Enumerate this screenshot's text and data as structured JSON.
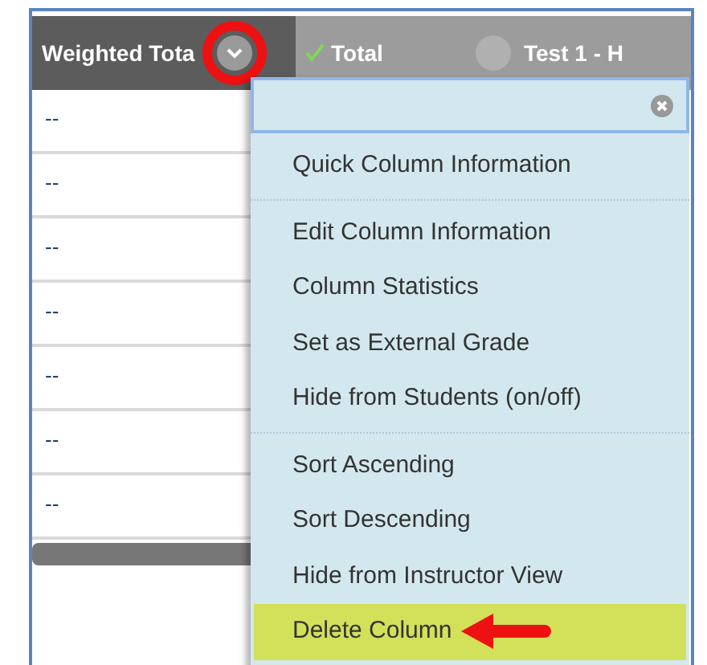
{
  "columns": [
    {
      "title": "Weighted Tota",
      "kind": "menu-open"
    },
    {
      "title": "Total",
      "kind": "checked"
    },
    {
      "title": "Test 1 - H",
      "kind": "menu"
    }
  ],
  "rows": [
    "--",
    "--",
    "--",
    "--",
    "--",
    "--",
    "--"
  ],
  "menu": {
    "groups": [
      [
        {
          "label": "Quick Column Information",
          "selected": false
        }
      ],
      [
        {
          "label": "Edit Column Information",
          "selected": false
        },
        {
          "label": "Column Statistics",
          "selected": false
        },
        {
          "label": "Set as External Grade",
          "selected": false
        },
        {
          "label": "Hide from Students (on/off)",
          "selected": false
        }
      ],
      [
        {
          "label": "Sort Ascending",
          "selected": false
        },
        {
          "label": "Sort Descending",
          "selected": false
        },
        {
          "label": "Hide from Instructor View",
          "selected": false
        },
        {
          "label": "Delete Column",
          "selected": true
        }
      ]
    ]
  }
}
